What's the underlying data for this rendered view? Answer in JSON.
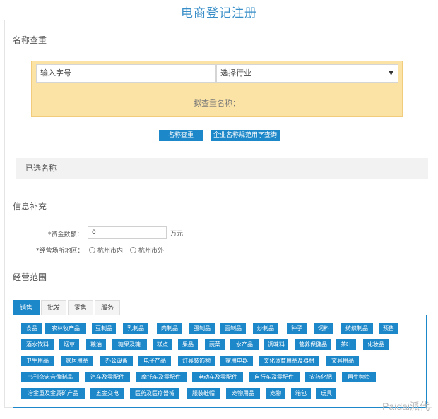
{
  "title": "电商登记注册",
  "name_check": {
    "heading": "名称查重",
    "name_input_value": "输入字号",
    "industry_select_value": "选择行业",
    "proposed_label": "拟查重名称：",
    "btn_check": "名称查重",
    "btn_rules": "企业名称规范用字查询"
  },
  "selected": {
    "label": "已选名称"
  },
  "info": {
    "heading": "信息补充",
    "capital_label": "*资金数额：",
    "capital_value": "0",
    "capital_unit": "万元",
    "location_label": "*经营场所地区：",
    "location_options": [
      "杭州市内",
      "杭州市外"
    ]
  },
  "scope": {
    "heading": "经营范围",
    "tabs": [
      "销售",
      "批发",
      "零售",
      "服务"
    ],
    "active_tab": "销售",
    "tags": [
      [
        "食品",
        "农林牧产品",
        "豆制品",
        "乳制品",
        "肉制品",
        "蛋制品",
        "面制品",
        "炒制品",
        "种子",
        "饲料",
        "纺织制品",
        "预售"
      ],
      [
        "酒水饮料",
        "烟草",
        "粮油",
        "糖果及糖",
        "糕点",
        "果品",
        "蔬菜",
        "水产品",
        "调味料",
        "营养保健品",
        "茶叶",
        "化妆品"
      ],
      [
        "卫生用品",
        "家居用品",
        "办公设备",
        "电子产品",
        "灯具装饰物",
        "家用电器",
        "文化体育用品及器材",
        "文具用品"
      ],
      [
        "书刊杂志音像制品",
        "汽车及零配件",
        "摩托车及零配件",
        "电动车及零配件",
        "自行车及零配件",
        "农药化肥",
        "再生物资"
      ],
      [
        "冶金重及金属矿产品",
        "五金交电",
        "医药及医疗器械",
        "服装鞋帽",
        "宠物用品",
        "宠物",
        "箱包",
        "玩具"
      ]
    ]
  },
  "watermark": "Paidai派代"
}
